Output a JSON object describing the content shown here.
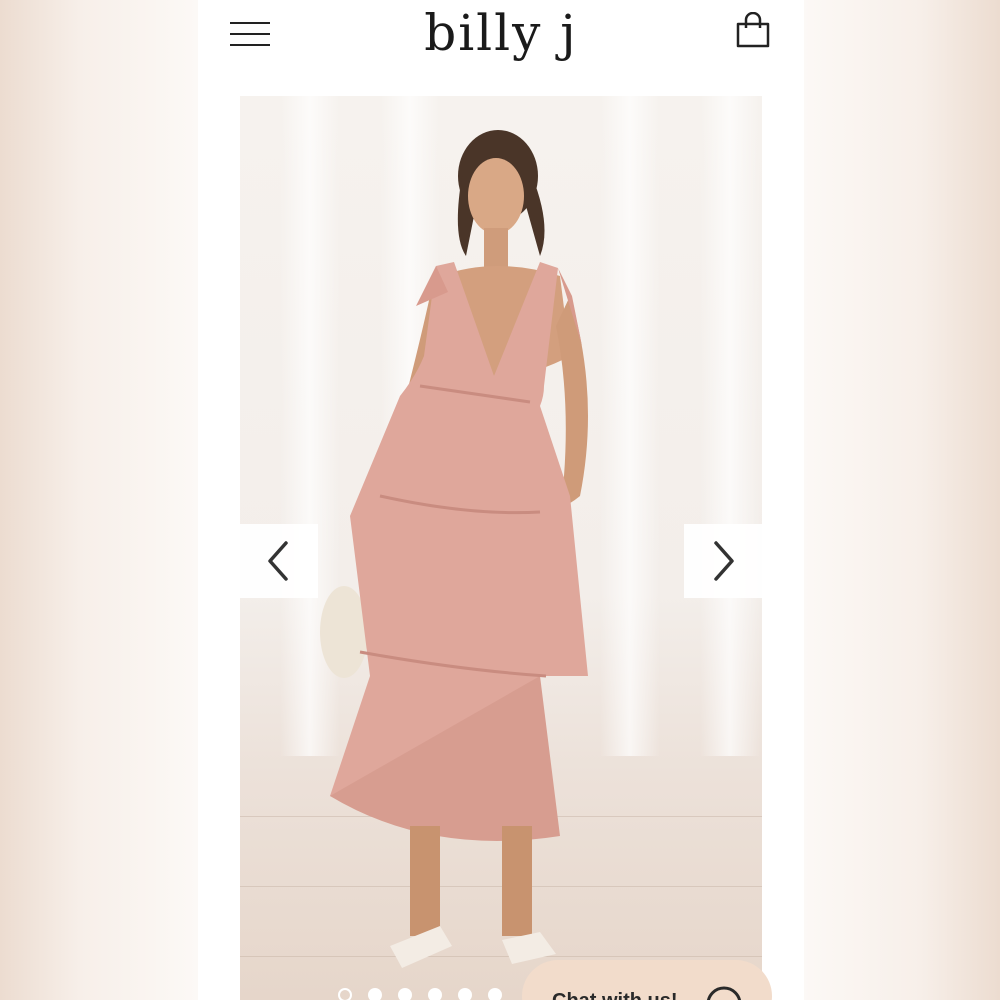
{
  "header": {
    "brand": "billy j",
    "menu_icon": "hamburger-menu-icon",
    "cart_icon": "shopping-bag-icon"
  },
  "gallery": {
    "image_alt": "Model wearing pink tiered tie-shoulder midi dress",
    "prev_icon": "chevron-left-icon",
    "next_icon": "chevron-right-icon",
    "slide_count": 6,
    "active_slide": 1
  },
  "chat": {
    "label": "Chat with us!",
    "icon": "chat-bubble-icon"
  },
  "colors": {
    "dress": "#dfa79b",
    "chat_bg": "#f2dccb",
    "text": "#1a1a1a"
  }
}
